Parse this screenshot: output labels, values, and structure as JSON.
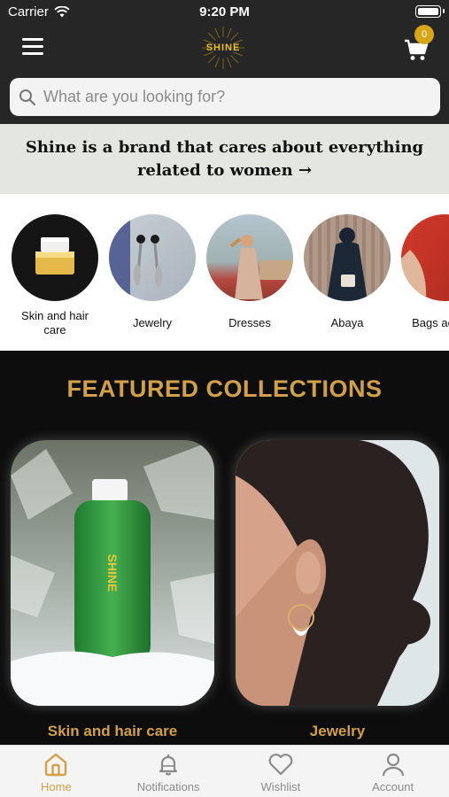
{
  "status_bar": {
    "carrier": "Carrier",
    "time": "9:20 PM"
  },
  "header": {
    "logo_text": "SHINE",
    "cart_count": "0"
  },
  "search": {
    "placeholder": "What are you looking for?"
  },
  "tagline": {
    "line1": "Shine is a brand that cares about everything",
    "line2": "related to women →"
  },
  "categories": [
    {
      "label": "Skin and hair care"
    },
    {
      "label": "Jewelry"
    },
    {
      "label": "Dresses"
    },
    {
      "label": "Abaya"
    },
    {
      "label": "Bags access"
    }
  ],
  "featured": {
    "title": "FEATURED COLLECTIONS",
    "cards": [
      {
        "label": "Skin and hair care",
        "product_text": "SHINE"
      },
      {
        "label": "Jewelry"
      }
    ]
  },
  "tabbar": [
    {
      "label": "Home",
      "icon": "home-icon",
      "active": true
    },
    {
      "label": "Notifications",
      "icon": "bell-icon"
    },
    {
      "label": "Wishlist",
      "icon": "heart-icon"
    },
    {
      "label": "Account",
      "icon": "person-icon"
    }
  ],
  "colors": {
    "accent": "#d2a04b",
    "header_bg": "#262626",
    "tagline_bg": "#e3e6e1"
  }
}
